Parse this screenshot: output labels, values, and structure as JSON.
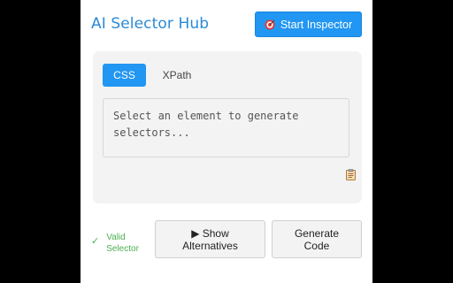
{
  "header": {
    "title": "AI Selector Hub",
    "start_button": "Start Inspector",
    "start_icon": "target-icon"
  },
  "tabs": [
    {
      "label": "CSS",
      "active": true
    },
    {
      "label": "XPath",
      "active": false
    }
  ],
  "selector_output": {
    "placeholder": "Select an element to generate selectors..."
  },
  "copy_icon": "clipboard-icon",
  "status": {
    "check": "✓",
    "line1": "Valid",
    "line2": "Selector"
  },
  "actions": {
    "alternatives_line1": "▶ Show",
    "alternatives_line2": "Alternatives",
    "generate_line1": "Generate",
    "generate_line2": "Code"
  },
  "colors": {
    "accent": "#2196f3",
    "title": "#2a8ad6",
    "valid": "#4caf50",
    "card_bg": "#f3f3f3"
  }
}
